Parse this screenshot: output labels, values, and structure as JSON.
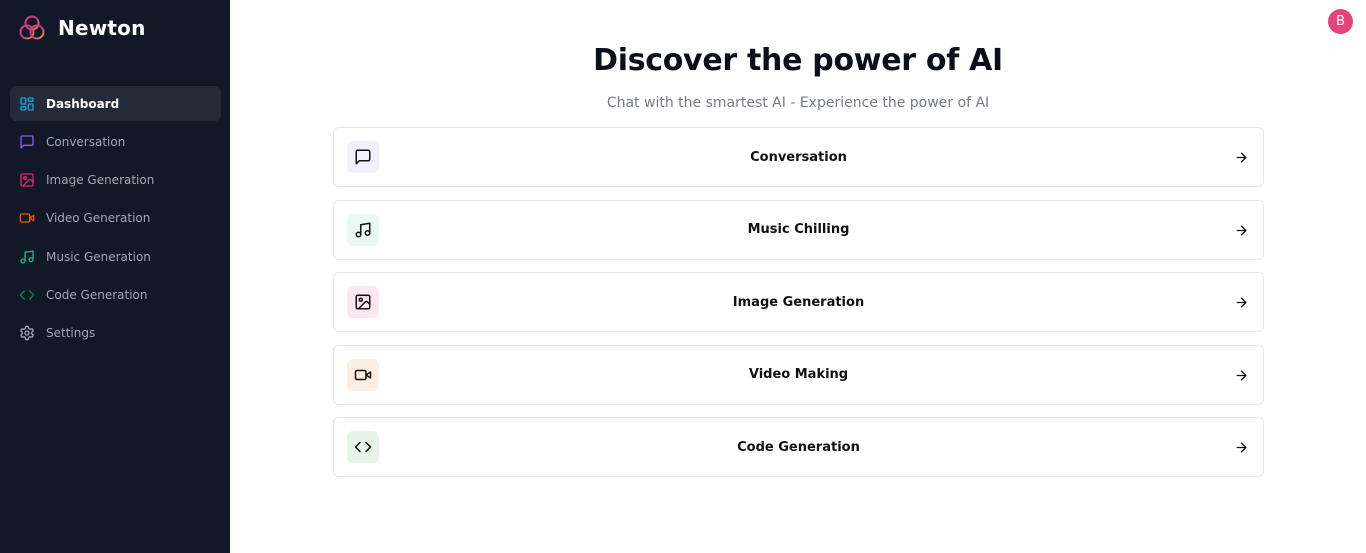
{
  "brand": {
    "name": "Newton",
    "logo_icon": "three-rings-logo-icon"
  },
  "sidebar": {
    "items": [
      {
        "label": "Dashboard",
        "icon": "layout-dashboard-icon",
        "color": "#0ea5e9",
        "active": true
      },
      {
        "label": "Conversation",
        "icon": "message-square-icon",
        "color": "#8b5cf6"
      },
      {
        "label": "Image Generation",
        "icon": "image-icon",
        "color": "#db2777"
      },
      {
        "label": "Video Generation",
        "icon": "video-icon",
        "color": "#ea580c"
      },
      {
        "label": "Music Generation",
        "icon": "music-icon",
        "color": "#10b981"
      },
      {
        "label": "Code Generation",
        "icon": "code-icon",
        "color": "#15803d"
      },
      {
        "label": "Settings",
        "icon": "settings-icon",
        "color": "#a1a6b3"
      }
    ]
  },
  "user": {
    "avatar_letter": "B",
    "avatar_color": "#e8427c"
  },
  "main": {
    "title": "Discover the power of AI",
    "subtitle": "Chat with the smartest AI - Experience the power of AI",
    "cards": [
      {
        "label": "Conversation",
        "icon": "message-square-icon",
        "bg": "#f3f0fe"
      },
      {
        "label": "Music Chilling",
        "icon": "music-icon",
        "bg": "#e8f8f2"
      },
      {
        "label": "Image Generation",
        "icon": "image-icon",
        "bg": "#fbe7f0"
      },
      {
        "label": "Video Making",
        "icon": "video-icon",
        "bg": "#fdeee4"
      },
      {
        "label": "Code Generation",
        "icon": "code-icon",
        "bg": "#e6f4ea"
      }
    ]
  }
}
